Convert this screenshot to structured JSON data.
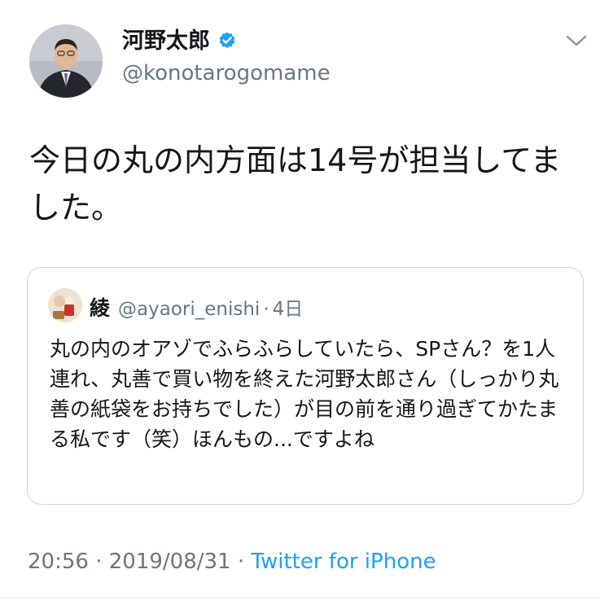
{
  "author": {
    "display_name": "河野太郎",
    "handle": "@konotarogomame",
    "verified_icon": "verified-badge-icon"
  },
  "tweet": {
    "text": "今日の丸の内方面は14号が担当してました。"
  },
  "quoted_tweet": {
    "display_name": "綾",
    "handle": "@ayaori_enishi",
    "separator": "·",
    "time": "4日",
    "text": "丸の内のオアゾでふらふらしていたら、SPさん？を1人連れ、丸善で買い物を終えた河野太郎さん（しっかり丸善の紙袋をお持ちでした）が目の前を通り過ぎてかたまる私です（笑）ほんもの...ですよね"
  },
  "meta": {
    "time": "20:56",
    "separator1": " · ",
    "date": "2019/08/31",
    "separator2": " · ",
    "source": "Twitter for iPhone"
  },
  "colors": {
    "accent": "#1da1f2",
    "secondary_text": "#657786",
    "border": "#ccd6dd"
  },
  "icons": {
    "menu": "chevron-down-icon"
  }
}
